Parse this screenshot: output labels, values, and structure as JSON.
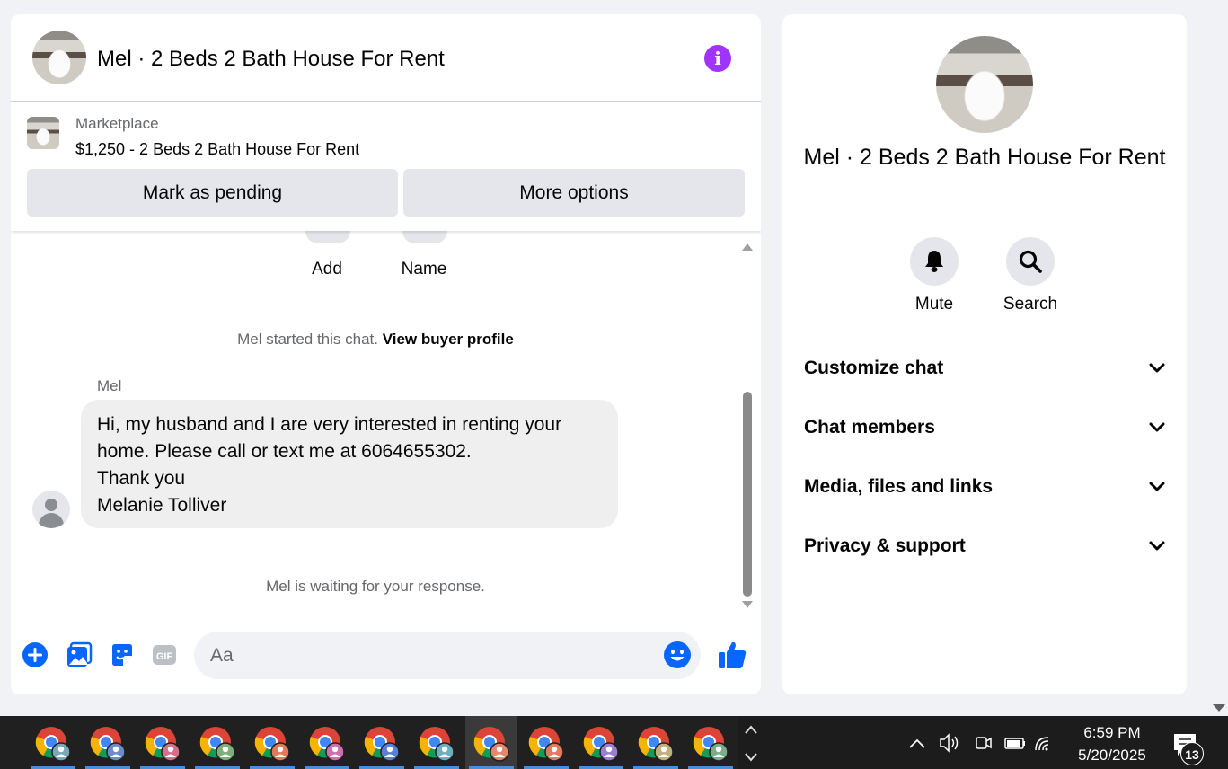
{
  "chat": {
    "title": "Mel · 2 Beds 2 Bath House For Rent",
    "listing": {
      "label": "Marketplace",
      "price_title": "$1,250 - 2 Beds 2 Bath House For Rent",
      "mark_pending": "Mark as pending",
      "more_options": "More options"
    },
    "top_actions": [
      "Add",
      "Name"
    ],
    "started_text": "Mel started this chat.",
    "view_profile": "View buyer profile",
    "sender": "Mel",
    "message_lines": [
      "Hi, my husband and I are very interested in renting your",
      "home.  Please call or text me at 6064655302.",
      "Thank you",
      "Melanie Tolliver"
    ],
    "waiting_text": "Mel is waiting for your response.",
    "composer_placeholder": "Aa"
  },
  "info": {
    "name": "Mel · 2 Beds 2 Bath House For Rent",
    "actions": {
      "mute": "Mute",
      "search": "Search"
    },
    "sections": [
      "Customize chat",
      "Chat members",
      "Media, files and links",
      "Privacy & support"
    ]
  },
  "taskbar": {
    "time": "6:59 PM",
    "date": "5/20/2025",
    "notifications": "13",
    "app_count": 13,
    "profile_colors": [
      "#7aa7b8",
      "#6a8cc7",
      "#d6708a",
      "#7fae7a",
      "#e07b5a",
      "#d06fb0",
      "#5a7fd6",
      "#6ab0c0",
      "#e08a6a",
      "#e07b5a",
      "#9b7fd6",
      "#c0b07a",
      "#7aae8a"
    ]
  },
  "colors": {
    "accent": "#0866ff",
    "info": "#a033ff"
  }
}
